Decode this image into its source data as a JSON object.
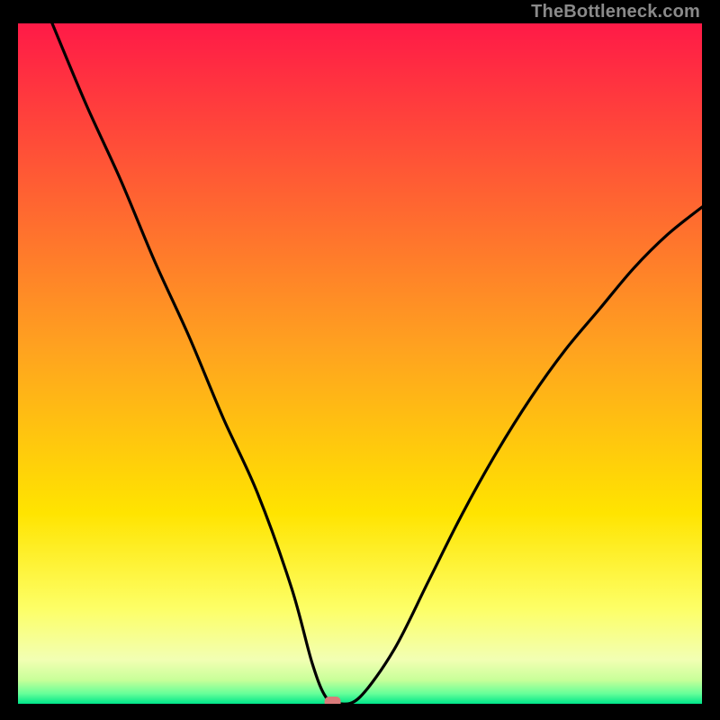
{
  "attribution": "TheBottleneck.com",
  "chart_data": {
    "type": "line",
    "title": "",
    "xlabel": "",
    "ylabel": "",
    "xlim": [
      0,
      100
    ],
    "ylim": [
      0,
      100
    ],
    "x": [
      5,
      10,
      15,
      20,
      25,
      30,
      35,
      40,
      43,
      45,
      47,
      50,
      55,
      60,
      65,
      70,
      75,
      80,
      85,
      90,
      95,
      100
    ],
    "y": [
      100,
      88,
      77,
      65,
      54,
      42,
      31,
      17,
      6,
      1,
      0,
      1,
      8,
      18,
      28,
      37,
      45,
      52,
      58,
      64,
      69,
      73
    ],
    "minimum_x": 46,
    "marker": {
      "x": 46,
      "y": 0
    },
    "background": {
      "type": "vertical-gradient",
      "stops": [
        {
          "pos": 0.0,
          "color": "#ff1a47"
        },
        {
          "pos": 0.48,
          "color": "#ffa31f"
        },
        {
          "pos": 0.72,
          "color": "#ffe400"
        },
        {
          "pos": 0.86,
          "color": "#fdff66"
        },
        {
          "pos": 0.935,
          "color": "#f2ffb3"
        },
        {
          "pos": 0.965,
          "color": "#c8ff99"
        },
        {
          "pos": 0.985,
          "color": "#66ff99"
        },
        {
          "pos": 1.0,
          "color": "#00e58a"
        }
      ]
    }
  }
}
